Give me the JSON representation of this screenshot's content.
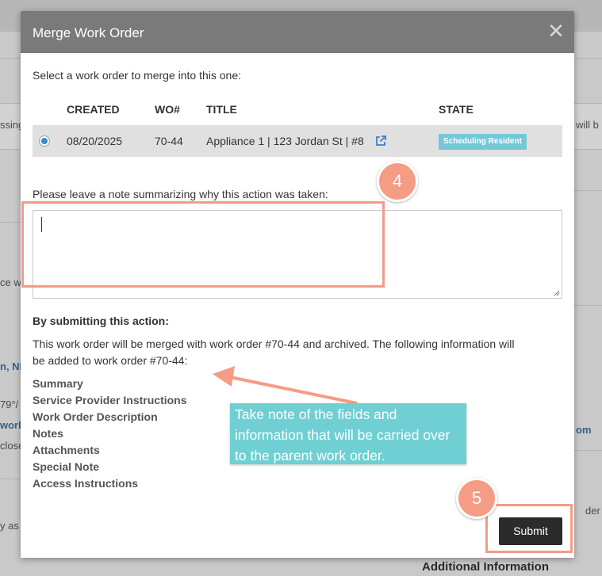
{
  "background": {
    "fragments": [
      "ssing",
      "ce w",
      "n, NI",
      "79°/",
      "work",
      "close",
      "y as",
      "will b",
      "om",
      "der to"
    ],
    "additional_info": "Additional Information"
  },
  "modal": {
    "title": "Merge Work Order",
    "close_glyph": "✕",
    "instruction": "Select a work order to merge into this one:",
    "columns": [
      "CREATED",
      "WO#",
      "TITLE",
      "STATE"
    ],
    "work_orders": [
      {
        "created": "08/20/2025",
        "wo_number": "70-44",
        "title": "Appliance 1 | 123 Jordan St | #8",
        "state": "Scheduling Resident",
        "selected": true
      }
    ],
    "note_label": "Please leave a note summarizing why this action was taken:",
    "note_value": "",
    "submitting_heading": "By submitting this action:",
    "summary_line1": "This work order will be merged with work order #70-44 and archived. The following information will",
    "summary_line2": "be added to work order #70-44:",
    "fields": [
      "Summary",
      "Service Provider Instructions",
      "Work Order Description",
      "Notes",
      "Attachments",
      "Special Note",
      "Access Instructions"
    ],
    "submit_label": "Submit"
  },
  "annotations": {
    "step4": "4",
    "step5": "5",
    "tooltip": "Take note of the fields and information that will be carried over to the parent work order.",
    "accent_color": "#f59c85",
    "tooltip_color": "#6fcfd3"
  }
}
